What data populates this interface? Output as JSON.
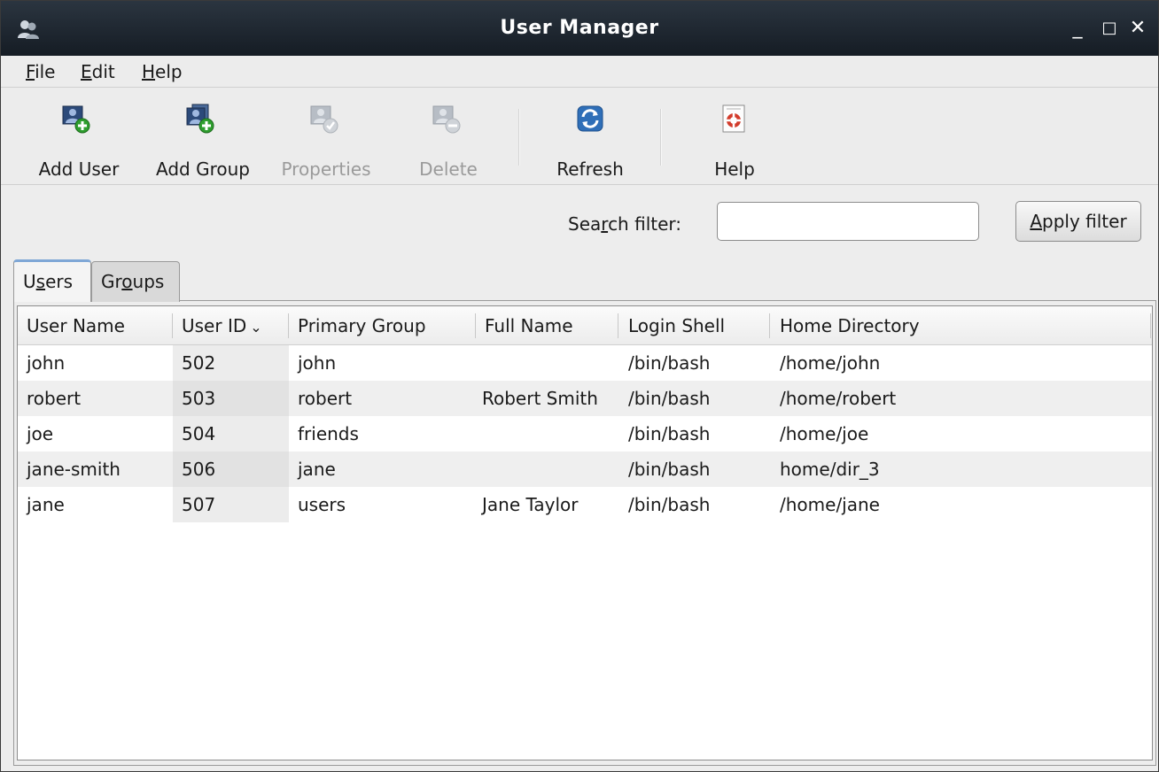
{
  "window": {
    "title": "User Manager",
    "controls": {
      "minimize": "_",
      "maximize": "□",
      "close": "✕"
    }
  },
  "menu": {
    "file": {
      "mnemonic": "F",
      "rest": "ile"
    },
    "edit": {
      "mnemonic": "E",
      "rest": "dit"
    },
    "help": {
      "mnemonic": "H",
      "rest": "elp"
    }
  },
  "toolbar": {
    "add_user": {
      "label": "Add User",
      "icon": "add-user-icon",
      "enabled": true
    },
    "add_group": {
      "label": "Add Group",
      "icon": "add-group-icon",
      "enabled": true
    },
    "properties": {
      "label": "Properties",
      "icon": "properties-icon",
      "enabled": false
    },
    "delete": {
      "label": "Delete",
      "icon": "delete-icon",
      "enabled": false
    },
    "refresh": {
      "label": "Refresh",
      "icon": "refresh-icon",
      "enabled": true
    },
    "help": {
      "label": "Help",
      "icon": "help-lifebuoy-icon",
      "enabled": true
    }
  },
  "search": {
    "label_pre": "Sea",
    "label_mnemonic": "r",
    "label_post": "ch filter:",
    "value": "",
    "apply_mnemonic": "A",
    "apply_rest": "pply filter"
  },
  "tabs": {
    "users": {
      "pre": "U",
      "mnemonic": "s",
      "post": "ers",
      "active": true
    },
    "groups": {
      "pre": "Gr",
      "mnemonic": "o",
      "post": "ups",
      "active": false
    }
  },
  "table": {
    "columns": [
      "User Name",
      "User ID",
      "Primary Group",
      "Full Name",
      "Login Shell",
      "Home Directory"
    ],
    "sort_indicator": "⌄",
    "rows": [
      [
        "john",
        "502",
        "john",
        "",
        "/bin/bash",
        "/home/john"
      ],
      [
        "robert",
        "503",
        "robert",
        "Robert Smith",
        "/bin/bash",
        "/home/robert"
      ],
      [
        "joe",
        "504",
        "friends",
        "",
        "/bin/bash",
        "/home/joe"
      ],
      [
        "jane-smith",
        "506",
        "jane",
        "",
        "/bin/bash",
        "home/dir_3"
      ],
      [
        "jane",
        "507",
        "users",
        "Jane Taylor",
        "/bin/bash",
        "/home/jane"
      ]
    ]
  },
  "colors": {
    "titlebar": "#1d252e",
    "add_badge": "#2e9e2e",
    "refresh_blue": "#2f6fb8",
    "help_red": "#d23b2b",
    "disabled_text": "#9a9a9a"
  }
}
